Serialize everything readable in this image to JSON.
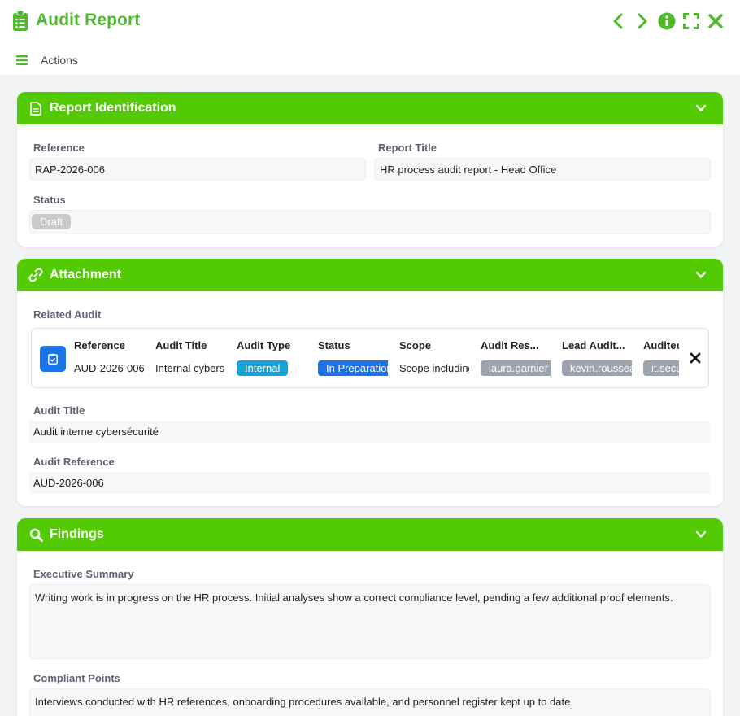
{
  "app": {
    "title": "Audit Report",
    "icons": [
      "clipboard-list-icon",
      "chevron-left-icon",
      "chevron-right-icon",
      "info-icon",
      "expand-icon",
      "close-icon"
    ],
    "accent": "#52cb04"
  },
  "menu": {
    "actions_label": "Actions"
  },
  "sections": {
    "identification": {
      "title": "Report Identification",
      "reference_label": "Reference",
      "reference_value": "RAP-2026-006",
      "report_title_label": "Report Title",
      "report_title_value": "HR process audit report - Head Office",
      "status_label": "Status",
      "status_value": "Draft"
    },
    "attachment": {
      "title": "Attachment",
      "related_audit_label": "Related Audit",
      "related_audit": {
        "reference_header": "Reference",
        "reference_value": "AUD-2026-006",
        "audit_title_header": "Audit Title",
        "audit_title_value": "Internal cybersecurity audit",
        "audit_type_header": "Audit Type",
        "audit_type_value": "Internal",
        "status_header": "Status",
        "status_value": "In Preparation",
        "scope_header": "Scope",
        "scope_value": "Scope including",
        "audit_res_header": "Audit Res...",
        "audit_res_value": "laura.garnier",
        "lead_auditor_header": "Lead Audit...",
        "lead_auditor_value": "kevin.rousseau",
        "auditee_header": "Auditee",
        "auditee_value": "it.security"
      },
      "audit_title_label": "Audit Title",
      "audit_title_value": "Audit interne cybersécurité",
      "audit_reference_label": "Audit Reference",
      "audit_reference_value": "AUD-2026-006"
    },
    "findings": {
      "title": "Findings",
      "executive_summary_label": "Executive Summary",
      "executive_summary_value": "Writing work is in progress on the HR process. Initial analyses show a correct compliance level, pending a few additional proof elements.",
      "compliant_points_label": "Compliant Points",
      "compliant_points_value": "Interviews conducted with HR references, onboarding procedures available, and personnel register kept up to date."
    }
  }
}
